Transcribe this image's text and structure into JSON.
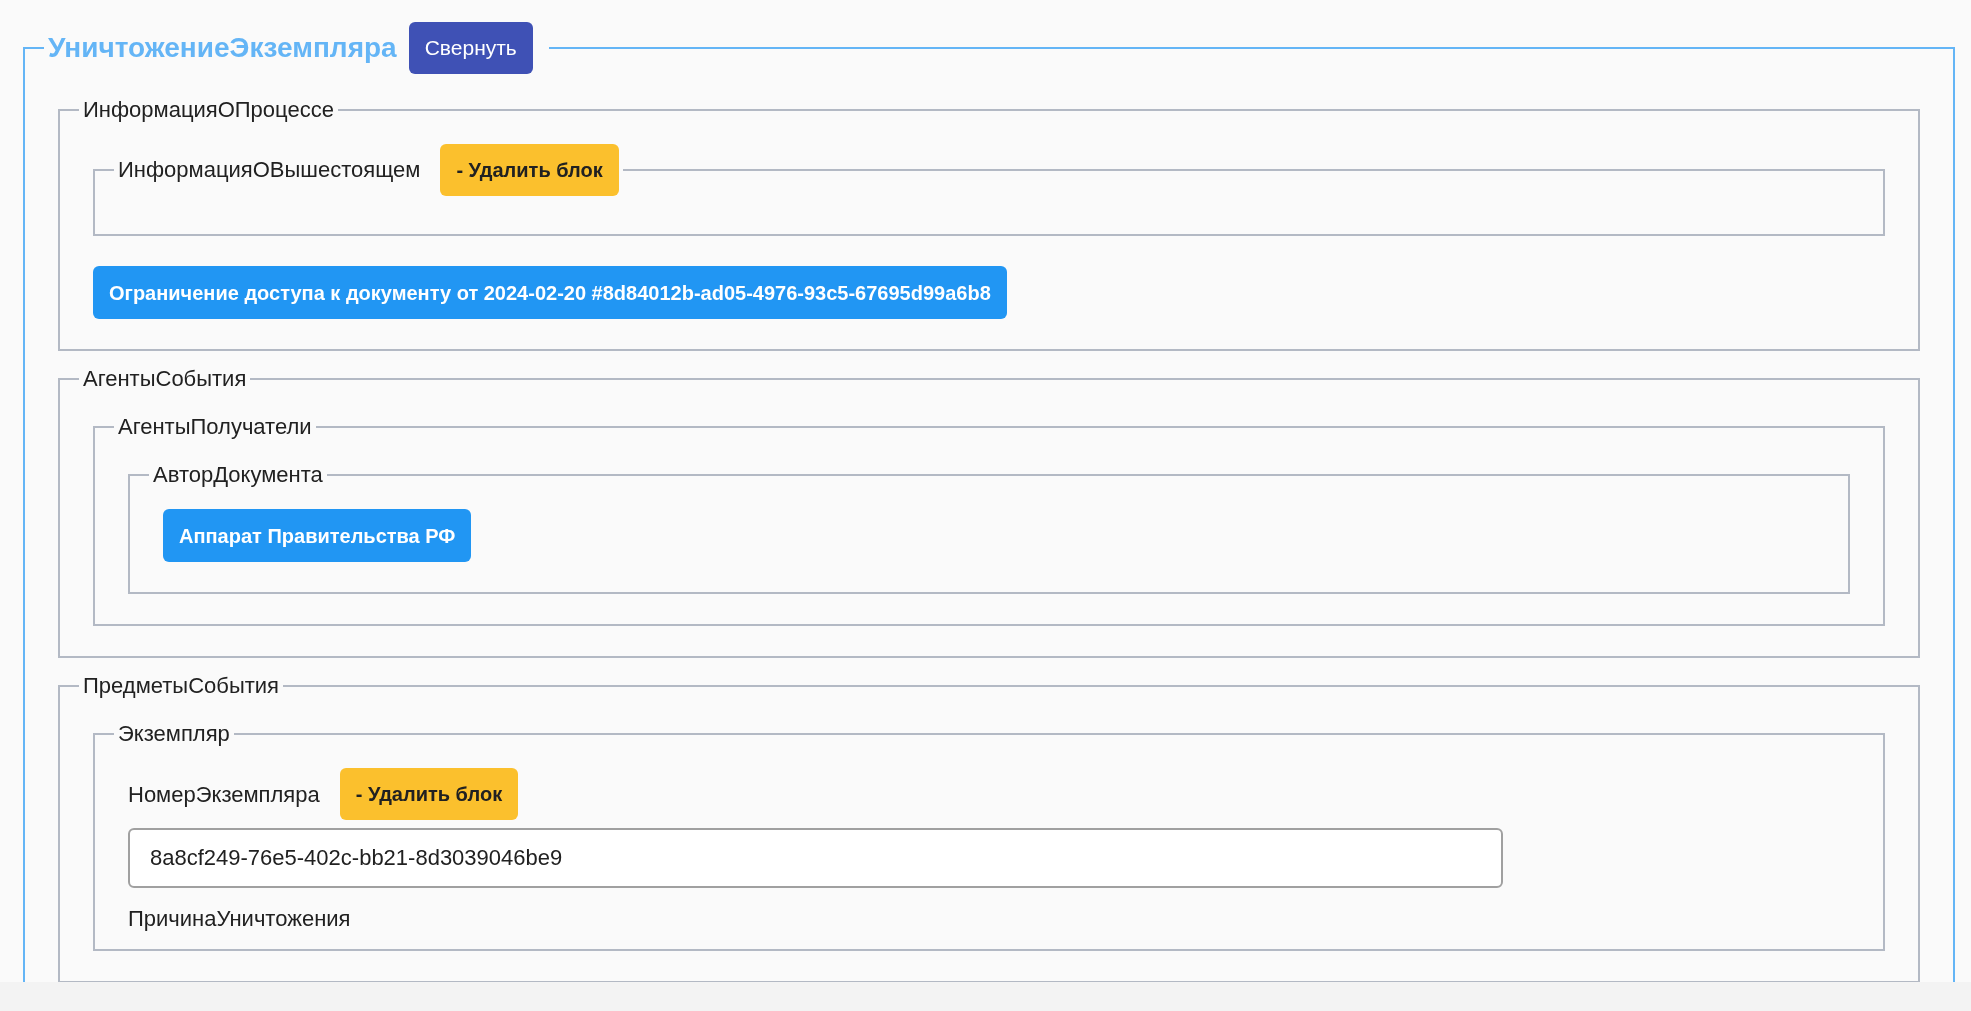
{
  "title": "УничтожениеЭкземпляра",
  "collapse_button": "Свернуть",
  "items": [
    {
      "kind": "group",
      "legend": "ИнформацияОПроцессе",
      "children": [
        {
          "kind": "group",
          "legend": "ИнформацияОВышестоящем",
          "action": "- Удалить блок"
        },
        {
          "kind": "link",
          "label": "Ограничение доступа к документу от 2024-02-20 #8d84012b-ad05-4976-93c5-67695d99a6b8"
        }
      ]
    },
    {
      "kind": "group",
      "legend": "АгентыСобытия",
      "children": [
        {
          "kind": "group",
          "legend": "АгентыПолучатели",
          "children": [
            {
              "kind": "group",
              "legend": "АвторДокумента",
              "children": [
                {
                  "kind": "link",
                  "label": "Аппарат Правительства РФ"
                }
              ]
            }
          ]
        }
      ]
    },
    {
      "kind": "group",
      "legend": "ПредметыСобытия",
      "children": [
        {
          "kind": "group",
          "legend": "Экземпляр",
          "children": [
            {
              "kind": "field",
              "label": "НомерЭкземпляра",
              "action": "- Удалить блок",
              "value": "8a8cf249-76e5-402c-bb21-8d3039046be9"
            },
            {
              "kind": "field",
              "label": "ПричинаУничтожения"
            }
          ]
        }
      ]
    }
  ]
}
